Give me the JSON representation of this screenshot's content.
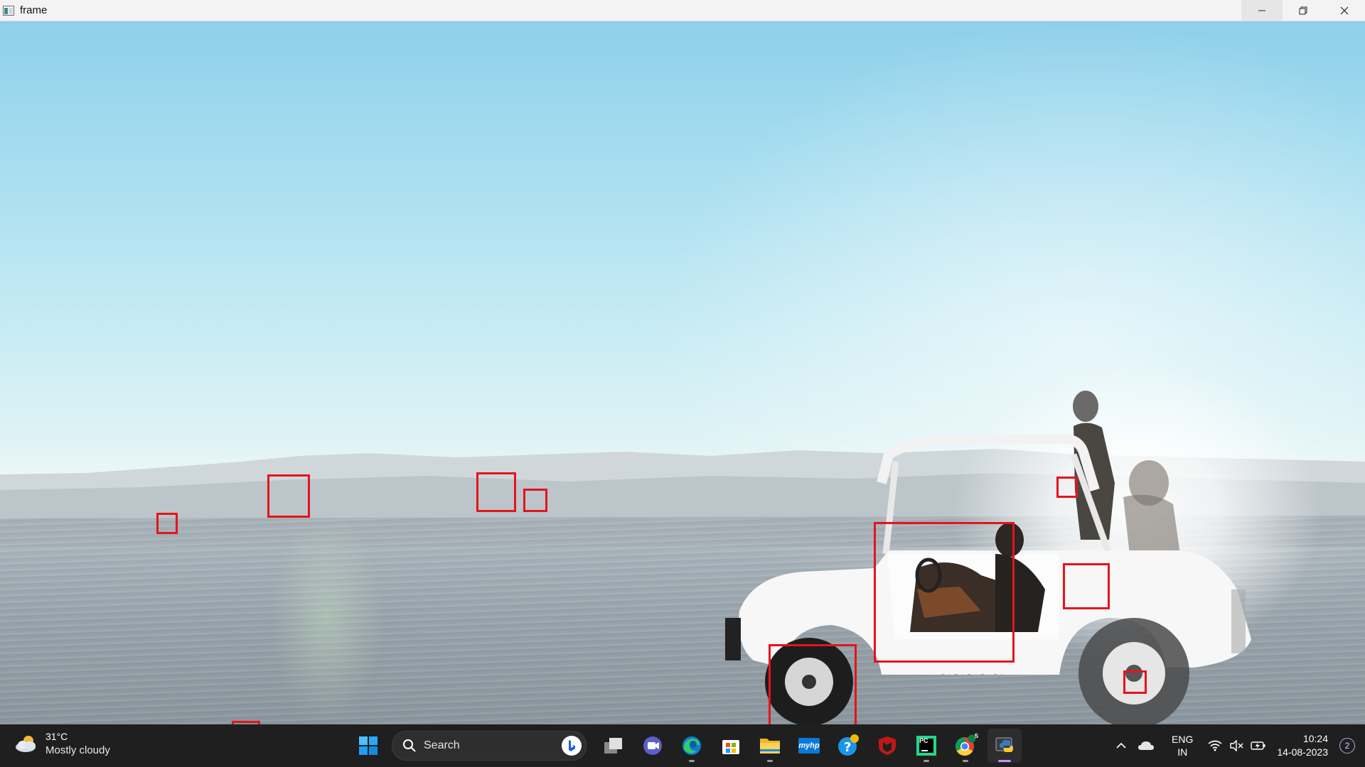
{
  "window": {
    "title": "frame"
  },
  "detections": {
    "color": "#e5141b",
    "count": 13
  },
  "taskbar": {
    "weather": {
      "temperature": "31°C",
      "condition": "Mostly cloudy"
    },
    "search": {
      "label": "Search"
    },
    "apps": [
      {
        "name": "Start",
        "icon": "windows-start-icon"
      },
      {
        "name": "Task view",
        "icon": "task-view-icon"
      },
      {
        "name": "Teams",
        "icon": "teams-icon"
      },
      {
        "name": "Microsoft Edge",
        "icon": "edge-icon",
        "running": true
      },
      {
        "name": "Microsoft Store",
        "icon": "store-icon"
      },
      {
        "name": "File Explorer",
        "icon": "folder-icon",
        "running": true
      },
      {
        "name": "myHP",
        "icon": "myhp-icon",
        "label": "myhp"
      },
      {
        "name": "Get Help",
        "icon": "help-icon"
      },
      {
        "name": "McAfee",
        "icon": "mcafee-icon"
      },
      {
        "name": "PyCharm",
        "icon": "pycharm-icon",
        "label": "PC",
        "running": true
      },
      {
        "name": "Google Chrome",
        "icon": "chrome-icon",
        "badge": "S",
        "running": true
      },
      {
        "name": "Python",
        "icon": "python-icon",
        "active": true
      }
    ],
    "tray": {
      "language": {
        "line1": "ENG",
        "line2": "IN"
      },
      "time": "10:24",
      "date": "14-08-2023",
      "notifications": "2"
    }
  }
}
